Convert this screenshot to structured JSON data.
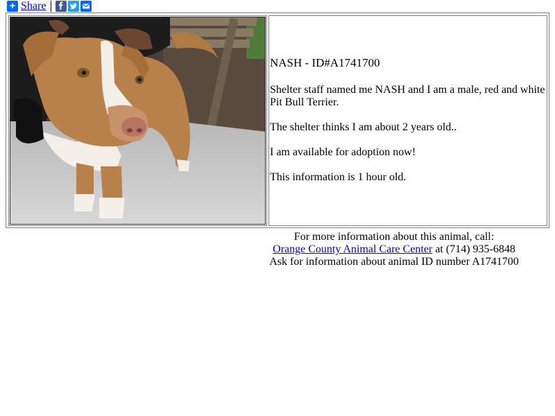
{
  "share": {
    "label": "Share",
    "plus_icon": "+",
    "social": [
      "facebook-icon",
      "twitter-icon",
      "email-icon"
    ],
    "colors": {
      "plus": "#0166ff",
      "facebook": "#3b5998",
      "twitter": "#1da1f2",
      "email": "#0166ff"
    }
  },
  "animal": {
    "title": "NASH - ID#A1741700",
    "desc": "Shelter staff named me NASH and I am a male, red and white Pit Bull Terrier.",
    "age": "The shelter thinks I am about 2 years old..",
    "status": "I am available for adoption now!",
    "freshness": "This information is 1 hour old.",
    "photo_alt": "Photo of NASH, a red and white Pit Bull Terrier"
  },
  "contact": {
    "line1": "For more information about this animal, call:",
    "shelter_name": "Orange County Animal Care Center",
    "at": "at",
    "phone": "(714) 935-6848",
    "line3": "Ask for information about animal ID number A1741700"
  }
}
